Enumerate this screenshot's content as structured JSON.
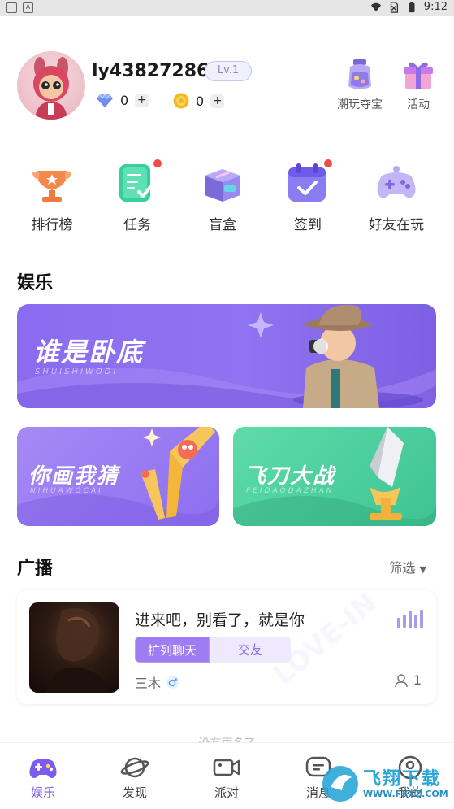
{
  "status_bar": {
    "time": "9:12"
  },
  "profile": {
    "username": "ly43827286",
    "level": "Lv.1",
    "diamonds": "0",
    "coins": "0",
    "plus": "+"
  },
  "top_actions": [
    {
      "label": "潮玩夺宝",
      "icon": "treasure-bottle-icon"
    },
    {
      "label": "活动",
      "icon": "gift-box-icon"
    }
  ],
  "quick_menu": [
    {
      "label": "排行榜",
      "icon": "trophy-icon",
      "badge": false
    },
    {
      "label": "任务",
      "icon": "task-icon",
      "badge": true
    },
    {
      "label": "盲盒",
      "icon": "blind-box-icon",
      "badge": false
    },
    {
      "label": "签到",
      "icon": "calendar-check-icon",
      "badge": true
    },
    {
      "label": "好友在玩",
      "icon": "gamepad-icon",
      "badge": false
    }
  ],
  "entertainment": {
    "title": "娱乐",
    "games": [
      {
        "title": "谁是卧底",
        "subtitle": "SHUISHIWODI"
      },
      {
        "title": "你画我猜",
        "subtitle": "NIHUAWOCAI"
      },
      {
        "title": "飞刀大战",
        "subtitle": "FEIDAODAZHAN"
      }
    ]
  },
  "broadcast": {
    "title": "广播",
    "filter": "筛选",
    "card": {
      "text": "进来吧，别看了，就是你",
      "tags": [
        "扩列聊天",
        "交友"
      ],
      "owner": "三木",
      "count": "1",
      "watermark": "LOVE-IN"
    },
    "more": "没有更多了"
  },
  "tabs": [
    {
      "label": "娱乐",
      "icon": "gamepad-icon",
      "active": true
    },
    {
      "label": "发现",
      "icon": "planet-icon",
      "active": false
    },
    {
      "label": "派对",
      "icon": "video-camera-icon",
      "active": false
    },
    {
      "label": "消息",
      "icon": "message-icon",
      "active": false
    },
    {
      "label": "我的",
      "icon": "profile-icon",
      "active": false
    }
  ],
  "overlay_watermark": {
    "title": "飞翔下载",
    "url": "WWW.FXXZ.COM"
  },
  "colors": {
    "accent": "#7c5cf0",
    "red_dot": "#f04a4a",
    "green_banner": "#45c89a",
    "purple_banner": "#8b6cf0"
  }
}
